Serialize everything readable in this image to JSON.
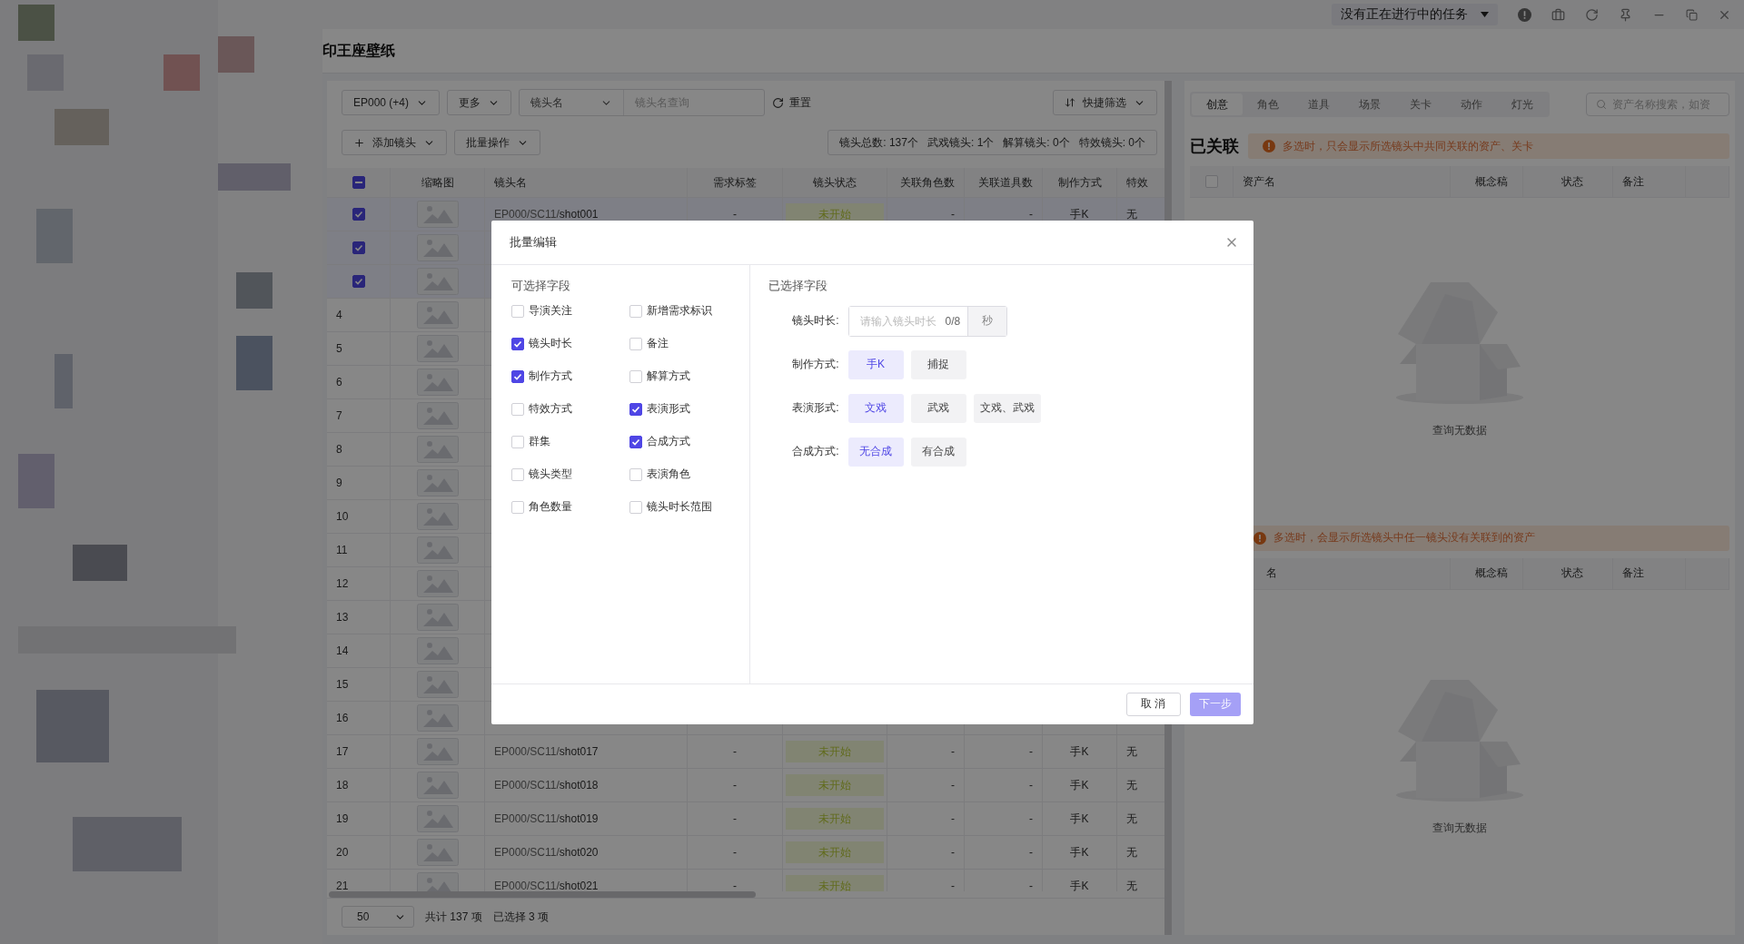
{
  "title_bar": {
    "task_status": "没有正在进行中的任务"
  },
  "page_title": "印王座壁纸",
  "filters": {
    "episode": "EP000 (+4)",
    "more": "更多",
    "search_by": "镜头名",
    "search_placeholder": "镜头名查询",
    "reset": "重置",
    "quick_filter": "快捷筛选"
  },
  "actions": {
    "add_shot": "添加镜头",
    "batch": "批量操作"
  },
  "stats": [
    "镜头总数: 137个",
    "武戏镜头: 1个",
    "解算镜头: 0个",
    "特效镜头: 0个"
  ],
  "shot_table": {
    "select_all_partial": true,
    "columns": [
      "缩略图",
      "镜头名",
      "需求标签",
      "镜头状态",
      "关联角色数",
      "关联道具数",
      "制作方式",
      "特效"
    ],
    "rows": [
      {
        "selected": true,
        "path": "EP000/SC11/",
        "name": "shot001",
        "tag": "-",
        "status": "未开始",
        "role_count": "-",
        "prop_count": "-",
        "method": "手K",
        "effect": "无"
      },
      {
        "selected": true
      },
      {
        "selected": true
      },
      {
        "number": "4",
        "selected": false
      },
      {
        "number": "5",
        "selected": false
      },
      {
        "number": "6",
        "selected": false
      },
      {
        "number": "7",
        "selected": false
      },
      {
        "number": "8",
        "selected": false
      },
      {
        "number": "9",
        "selected": false
      },
      {
        "number": "10",
        "selected": false
      },
      {
        "number": "11",
        "selected": false
      },
      {
        "number": "12",
        "selected": false
      },
      {
        "number": "13",
        "selected": false
      },
      {
        "number": "14",
        "selected": false
      },
      {
        "number": "15",
        "selected": false
      },
      {
        "number": "16",
        "selected": false
      },
      {
        "number": "17",
        "selected": false,
        "path": "EP000/SC11/",
        "name": "shot017",
        "tag": "-",
        "status": "未开始",
        "role_count": "-",
        "prop_count": "-",
        "method": "手K",
        "effect": "无"
      },
      {
        "number": "18",
        "selected": false,
        "path": "EP000/SC11/",
        "name": "shot018",
        "tag": "-",
        "status": "未开始",
        "role_count": "-",
        "prop_count": "-",
        "method": "手K",
        "effect": "无"
      },
      {
        "number": "19",
        "selected": false,
        "path": "EP000/SC11/",
        "name": "shot019",
        "tag": "-",
        "status": "未开始",
        "role_count": "-",
        "prop_count": "-",
        "method": "手K",
        "effect": "无"
      },
      {
        "number": "20",
        "selected": false,
        "path": "EP000/SC11/",
        "name": "shot020",
        "tag": "-",
        "status": "未开始",
        "role_count": "-",
        "prop_count": "-",
        "method": "手K",
        "effect": "无"
      },
      {
        "number": "21",
        "selected": false,
        "path": "EP000/SC11/",
        "name": "shot021",
        "tag": "-",
        "status": "未开始",
        "role_count": "-",
        "prop_count": "-",
        "method": "手K",
        "effect": "无"
      }
    ]
  },
  "pagination": {
    "page_size": "50",
    "total": "共计 137 项",
    "selected_count": "已选择 3 项"
  },
  "asset_panel": {
    "tabs": [
      {
        "label": "创意",
        "selected": true
      },
      {
        "label": "角色",
        "selected": false
      },
      {
        "label": "道具",
        "selected": false
      },
      {
        "label": "场景",
        "selected": false
      },
      {
        "label": "关卡",
        "selected": false
      },
      {
        "label": "动作",
        "selected": false
      },
      {
        "label": "灯光",
        "selected": false
      }
    ],
    "search_placeholder": "资产名称搜索，如资",
    "linked": {
      "heading": "已关联",
      "select_all_checked": false,
      "notice": "多选时，只会显示所选镜头中共同关联的资产、关卡",
      "columns": [
        "资产名",
        "概念稿",
        "状态",
        "备注"
      ],
      "empty_text": "查询无数据"
    },
    "unlinked": {
      "notice": "多选时，会显示所选镜头中任一镜头没有关联到的资产",
      "columns": [
        "名",
        "概念稿",
        "状态",
        "备注"
      ],
      "empty_text": "查询无数据"
    }
  },
  "dialog": {
    "title": "批量编辑",
    "available_heading": "可选择字段",
    "fields": [
      {
        "label": "导演关注",
        "checked": false
      },
      {
        "label": "新增需求标识",
        "checked": false
      },
      {
        "label": "镜头时长",
        "checked": true
      },
      {
        "label": "备注",
        "checked": false
      },
      {
        "label": "制作方式",
        "checked": true
      },
      {
        "label": "解算方式",
        "checked": false
      },
      {
        "label": "特效方式",
        "checked": false
      },
      {
        "label": "表演形式",
        "checked": true
      },
      {
        "label": "群集",
        "checked": false
      },
      {
        "label": "合成方式",
        "checked": true
      },
      {
        "label": "镜头类型",
        "checked": false
      },
      {
        "label": "表演角色",
        "checked": false
      },
      {
        "label": "角色数量",
        "checked": false
      },
      {
        "label": "镜头时长范围",
        "checked": false
      }
    ],
    "selected_heading": "已选择字段",
    "form": [
      {
        "kind": "input",
        "label": "镜头时长:",
        "placeholder": "请输入镜头时长",
        "count": "0/8",
        "unit": "秒"
      },
      {
        "kind": "options",
        "label": "制作方式:",
        "options": [
          {
            "label": "手K",
            "selected": true
          },
          {
            "label": "捕捉",
            "selected": false
          }
        ]
      },
      {
        "kind": "options",
        "label": "表演形式:",
        "options": [
          {
            "label": "文戏",
            "selected": true
          },
          {
            "label": "武戏",
            "selected": false
          },
          {
            "label": "文戏、武戏",
            "selected": false
          }
        ]
      },
      {
        "kind": "options",
        "label": "合成方式:",
        "options": [
          {
            "label": "无合成",
            "selected": true
          },
          {
            "label": "有合成",
            "selected": false
          }
        ]
      }
    ],
    "cancel": "取 消",
    "next": {
      "label": "下一步",
      "disabled": true
    }
  }
}
